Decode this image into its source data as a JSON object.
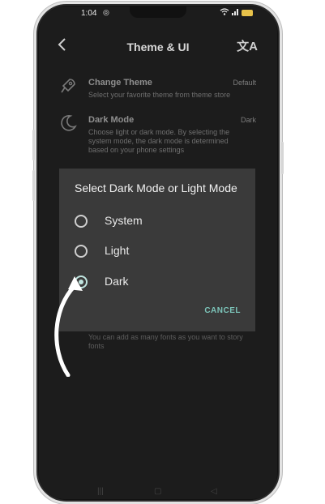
{
  "status_bar": {
    "time": "1:04",
    "notification_icon": "whatsapp-icon"
  },
  "header": {
    "title": "Theme & UI",
    "back_icon": "back-arrow-icon",
    "action_icon": "translate-icon"
  },
  "settings": [
    {
      "label": "Change Theme",
      "value": "Default",
      "description": "Select your favorite theme from theme store",
      "icon": "rocket-icon"
    },
    {
      "label": "Dark Mode",
      "value": "Dark",
      "description": "Choose light or dark mode. By selecting the system mode, the dark mode is determined based on your phone settings",
      "icon": "moon-icon"
    }
  ],
  "fonts_description": "You can add as many fonts as you want to story fonts",
  "dialog": {
    "title": "Select Dark Mode or Light Mode",
    "options": [
      {
        "label": "System",
        "selected": false
      },
      {
        "label": "Light",
        "selected": false
      },
      {
        "label": "Dark",
        "selected": true
      }
    ],
    "cancel_label": "CANCEL"
  },
  "colors": {
    "accent": "#7cc4b9",
    "dialog_bg": "#3a3a3a",
    "screen_bg": "#1c1c1c"
  }
}
